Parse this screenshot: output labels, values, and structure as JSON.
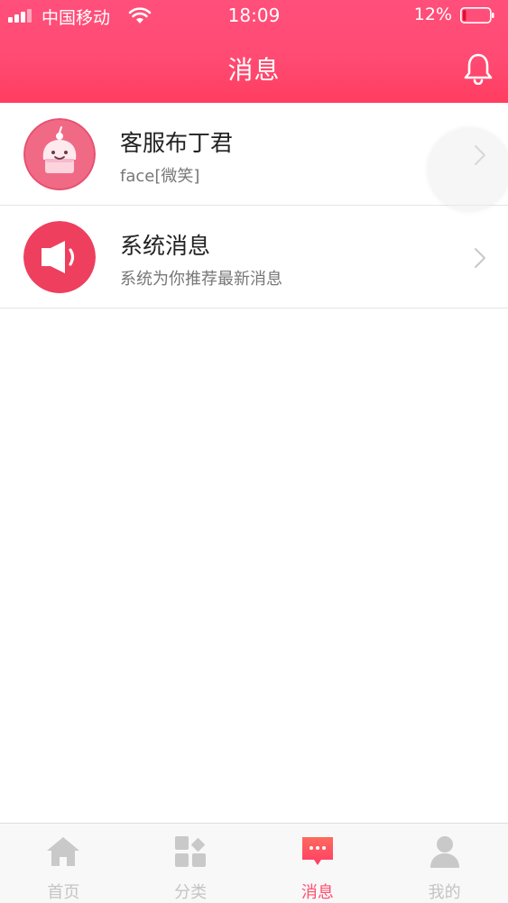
{
  "status_bar": {
    "carrier": "中国移动",
    "time": "18:09",
    "battery_percent": "12%",
    "battery_level": 0.12
  },
  "header": {
    "title": "消息",
    "right_icon": "bell-icon"
  },
  "messages": [
    {
      "title": "客服布丁君",
      "subtitle": "face[微笑]",
      "avatar_icon": "pudding-avatar-icon"
    },
    {
      "title": "系统消息",
      "subtitle": "系统为你推荐最新消息",
      "avatar_icon": "speaker-icon"
    }
  ],
  "tabbar": {
    "tabs": [
      {
        "label": "首页",
        "icon": "home-icon"
      },
      {
        "label": "分类",
        "icon": "category-icon"
      },
      {
        "label": "消息",
        "icon": "message-icon",
        "active": true
      },
      {
        "label": "我的",
        "icon": "user-icon"
      }
    ]
  },
  "colors": {
    "accent": "#ff4f6e",
    "header_gradient_top": "#ff4f7b",
    "header_gradient_bottom": "#ff3d60",
    "tab_inactive": "#c4c4c4"
  }
}
